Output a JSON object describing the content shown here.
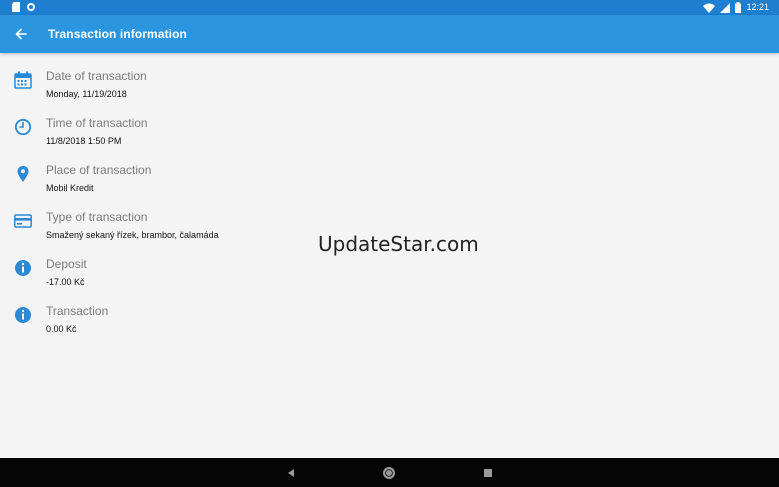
{
  "status_bar": {
    "time": "12:21",
    "icons": [
      "sd-card-icon",
      "sync-icon",
      "wifi-icon",
      "signal-icon",
      "battery-icon"
    ]
  },
  "app_bar": {
    "title": "Transaction information",
    "back_icon": "back-arrow-icon"
  },
  "details": [
    {
      "icon": "calendar-icon",
      "label": "Date of transaction",
      "value": "Monday, 11/19/2018"
    },
    {
      "icon": "clock-icon",
      "label": "Time of transaction",
      "value": "11/8/2018 1:50 PM"
    },
    {
      "icon": "location-pin-icon",
      "label": "Place of transaction",
      "value": "Mobil Kredit"
    },
    {
      "icon": "credit-card-icon",
      "label": "Type of transaction",
      "value": "Smažený sekaný řízek, brambor, čalamáda"
    },
    {
      "icon": "info-icon",
      "label": "Deposit",
      "value": "-17.00 Kč"
    },
    {
      "icon": "info-icon",
      "label": "Transaction",
      "value": "0.00 Kč"
    }
  ],
  "watermark": "UpdateStar.com",
  "colors": {
    "accent": "#2b95e0",
    "status_bar": "#1e7fd0",
    "icon": "#2b8ad6"
  },
  "nav_bar": {
    "buttons": [
      "back-triangle-icon",
      "home-circle-icon",
      "recents-square-icon"
    ]
  }
}
